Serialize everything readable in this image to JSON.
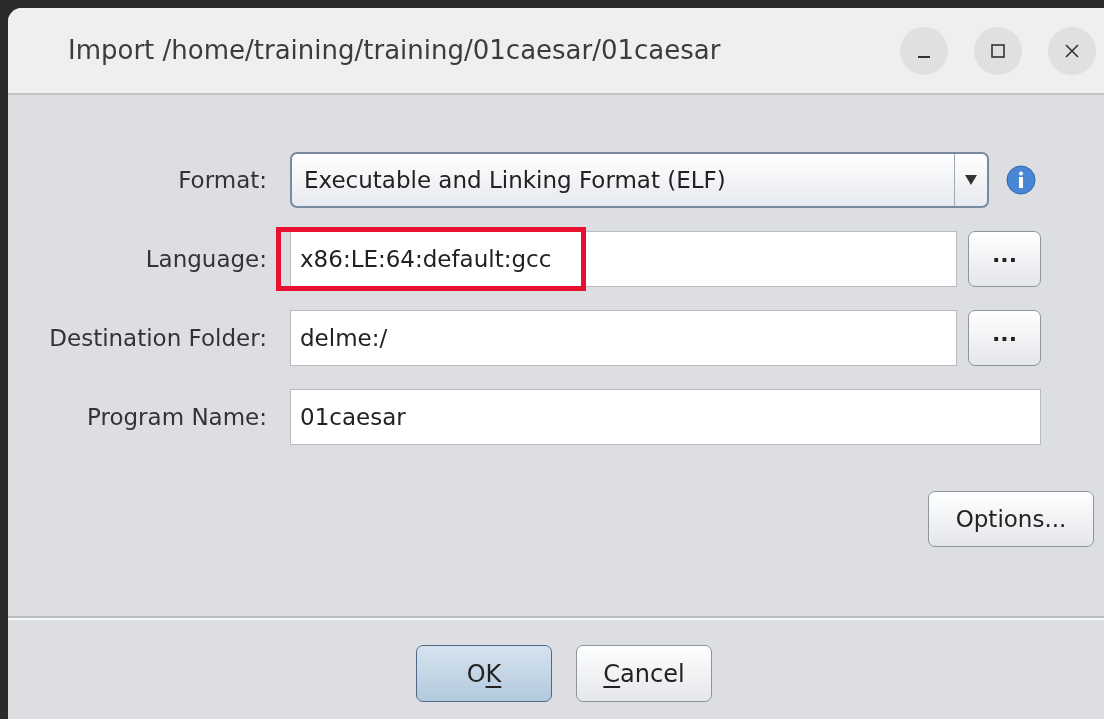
{
  "window": {
    "title": "Import /home/training/training/01caesar/01caesar"
  },
  "fields": [
    {
      "kind": "select",
      "label": "Format:",
      "value": "Executable and Linking Format (ELF)",
      "highlighted": false
    },
    {
      "kind": "browse",
      "label": "Language:",
      "value": "x86:LE:64:default:gcc",
      "highlighted": true,
      "button": "..."
    },
    {
      "kind": "browse",
      "label": "Destination Folder:",
      "value": "delme:/",
      "highlighted": false,
      "button": "..."
    },
    {
      "kind": "text",
      "label": "Program Name:",
      "value": "01caesar",
      "highlighted": false
    }
  ],
  "options_button": "Options...",
  "buttons": [
    {
      "label_parts": [
        {
          "text": "O",
          "underlined": false
        },
        {
          "text": "K",
          "underlined": true
        }
      ],
      "default": true
    },
    {
      "label_parts": [
        {
          "text": "C",
          "underlined": true
        },
        {
          "text": "ancel",
          "underlined": false
        }
      ],
      "default": false
    }
  ]
}
